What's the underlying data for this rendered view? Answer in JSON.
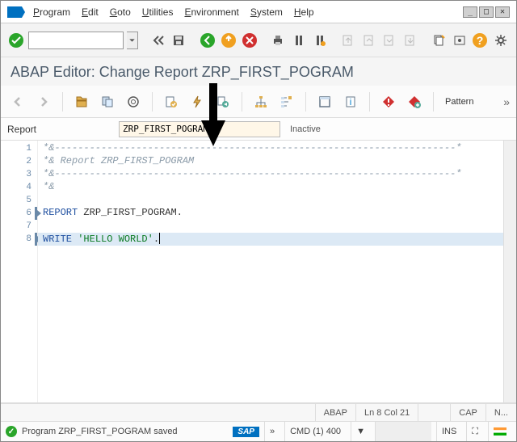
{
  "menu": {
    "items": [
      "Program",
      "Edit",
      "Goto",
      "Utilities",
      "Environment",
      "System",
      "Help"
    ]
  },
  "title": "ABAP Editor: Change Report ZRP_FIRST_POGRAM",
  "toolbar2": {
    "pattern": "Pattern"
  },
  "report": {
    "label": "Report",
    "value": "ZRP_FIRST_POGRAM",
    "status": "Inactive"
  },
  "code": {
    "lines": [
      "*&---------------------------------------------------------------------*",
      "*& Report ZRP_FIRST_POGRAM",
      "*&---------------------------------------------------------------------*",
      "*&",
      "",
      "REPORT ZRP_FIRST_POGRAM.",
      "",
      "WRITE 'HELLO WORLD'."
    ]
  },
  "status1": {
    "lang": "ABAP",
    "pos": "Ln    8 Col  21",
    "cap": "CAP",
    "num": "N..."
  },
  "status2": {
    "msg": "Program ZRP_FIRST_POGRAM saved",
    "client": "CMD (1) 400",
    "ins": "INS"
  }
}
